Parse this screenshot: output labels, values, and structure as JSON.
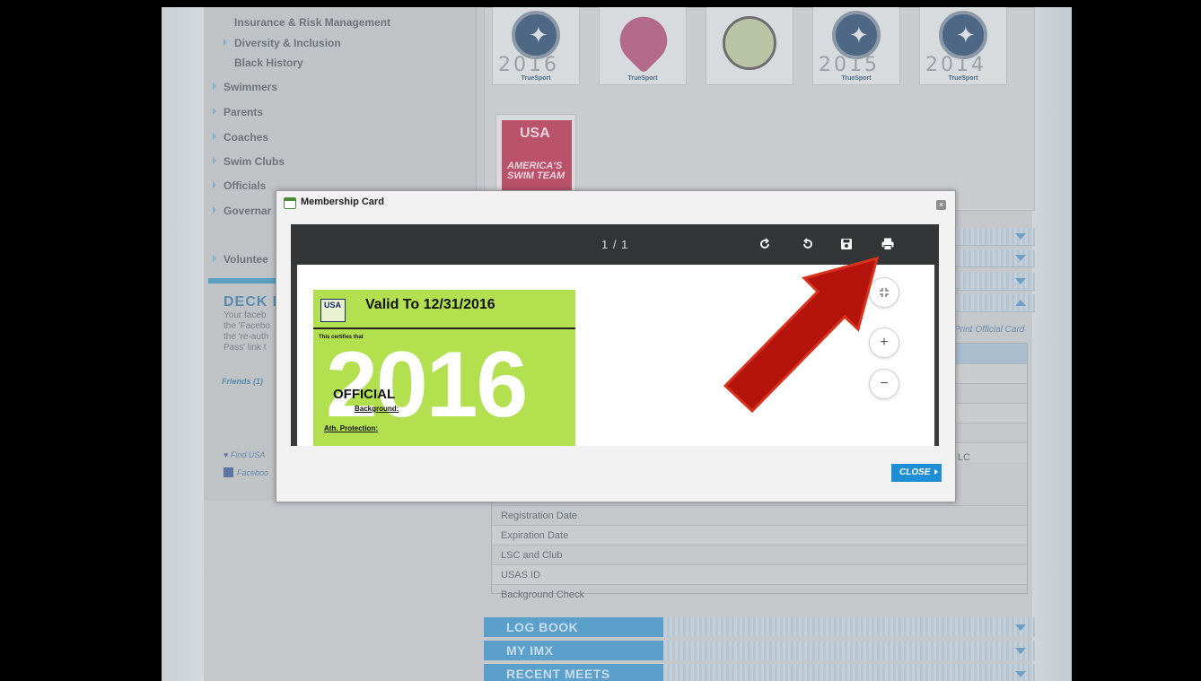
{
  "sidebar": {
    "items": [
      {
        "label": "Insurance & Risk Management",
        "arrow": false
      },
      {
        "label": "Diversity & Inclusion",
        "arrow": true
      },
      {
        "label": "Black History",
        "arrow": false
      },
      {
        "label": "Swimmers",
        "arrow": true
      },
      {
        "label": "Parents",
        "arrow": true
      },
      {
        "label": "Coaches",
        "arrow": true
      },
      {
        "label": "Swim Clubs",
        "arrow": true
      },
      {
        "label": "Officials",
        "arrow": true
      },
      {
        "label": "Governar",
        "arrow": true
      },
      {
        "label": "Voluntee",
        "arrow": true
      }
    ],
    "deck_title": "DECK P",
    "deck_text": [
      "Your faceb",
      "the 'Facebo",
      "the 're-auth",
      "Pass' link t"
    ],
    "friends": "Friends (1)",
    "find_link": "Find USA",
    "facebook_link": "Faceboo"
  },
  "badges": {
    "items": [
      {
        "year": "2016",
        "label": "TrueSport",
        "kind": "star"
      },
      {
        "year": "",
        "label": "TrueSport",
        "kind": "heart"
      },
      {
        "year": "",
        "label": "",
        "kind": "party"
      },
      {
        "year": "2015",
        "label": "TrueSport",
        "kind": "star"
      },
      {
        "year": "2014",
        "label": "TrueSport",
        "kind": "star"
      }
    ],
    "usa_badge": {
      "top": "USA",
      "bottom": "AMERICA'S SWIM TEAM"
    }
  },
  "details": {
    "official_card_link": "Print Official Card",
    "rows": [
      "",
      "",
      "",
      "",
      "",
      "Registration Date",
      "Expiration Date",
      "LSC and Club",
      "USAS ID",
      "Background Check"
    ],
    "club_fragment": "tro LC"
  },
  "bottom_bars": [
    "LOG BOOK",
    "MY IMX",
    "RECENT MEETS"
  ],
  "modal": {
    "title": "Membership Card",
    "close_label": "CLOSE",
    "viewer": {
      "page_indicator": "1 / 1",
      "toolbar_icons": [
        "rotate-clockwise-icon",
        "rotate-counterclockwise-icon",
        "save-icon",
        "print-icon"
      ]
    },
    "card": {
      "logo_text": "USA",
      "valid_to": "Valid To 12/31/2016",
      "certifies": "This certifies that",
      "year": "2016",
      "role": "OFFICIAL",
      "background": "Background:",
      "ath_protection": "Ath. Protection:"
    },
    "zoom_buttons": {
      "fit": "fit-page-icon",
      "plus": "+",
      "minus": "−"
    }
  },
  "annotation": {
    "color": "#b5140c",
    "target": "print-icon"
  }
}
